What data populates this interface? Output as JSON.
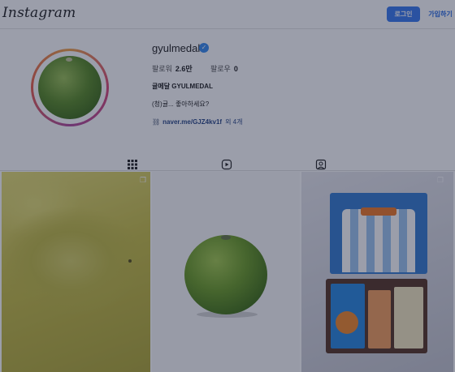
{
  "header": {
    "logo": "Instagram",
    "login_label": "로그인",
    "signup_label": "가입하기"
  },
  "profile": {
    "username": "gyulmedal",
    "verified": true,
    "stats": {
      "followers_label": "팔로워",
      "followers_value": "2.6만",
      "following_label": "팔로우",
      "following_value": "0"
    },
    "bio_name": "귤메달 GYULMEDAL",
    "bio_text": "(청)귤... 좋아하세요?",
    "link_text": "naver.me/GJZ4kv1f",
    "link_more": "외 4개"
  },
  "tabs": [
    {
      "name": "posts",
      "icon": "grid-icon",
      "active": true
    },
    {
      "name": "reels",
      "icon": "reels-icon",
      "active": false
    },
    {
      "name": "tagged",
      "icon": "tagged-icon",
      "active": false
    }
  ],
  "posts": [
    {
      "description": "yellow powder closeup",
      "multi": true
    },
    {
      "description": "green citrus fruit",
      "multi": false
    },
    {
      "description": "jersey and gift box",
      "multi": true
    }
  ],
  "colors": {
    "accent": "#3d7cf0",
    "overlay": "#111834"
  }
}
